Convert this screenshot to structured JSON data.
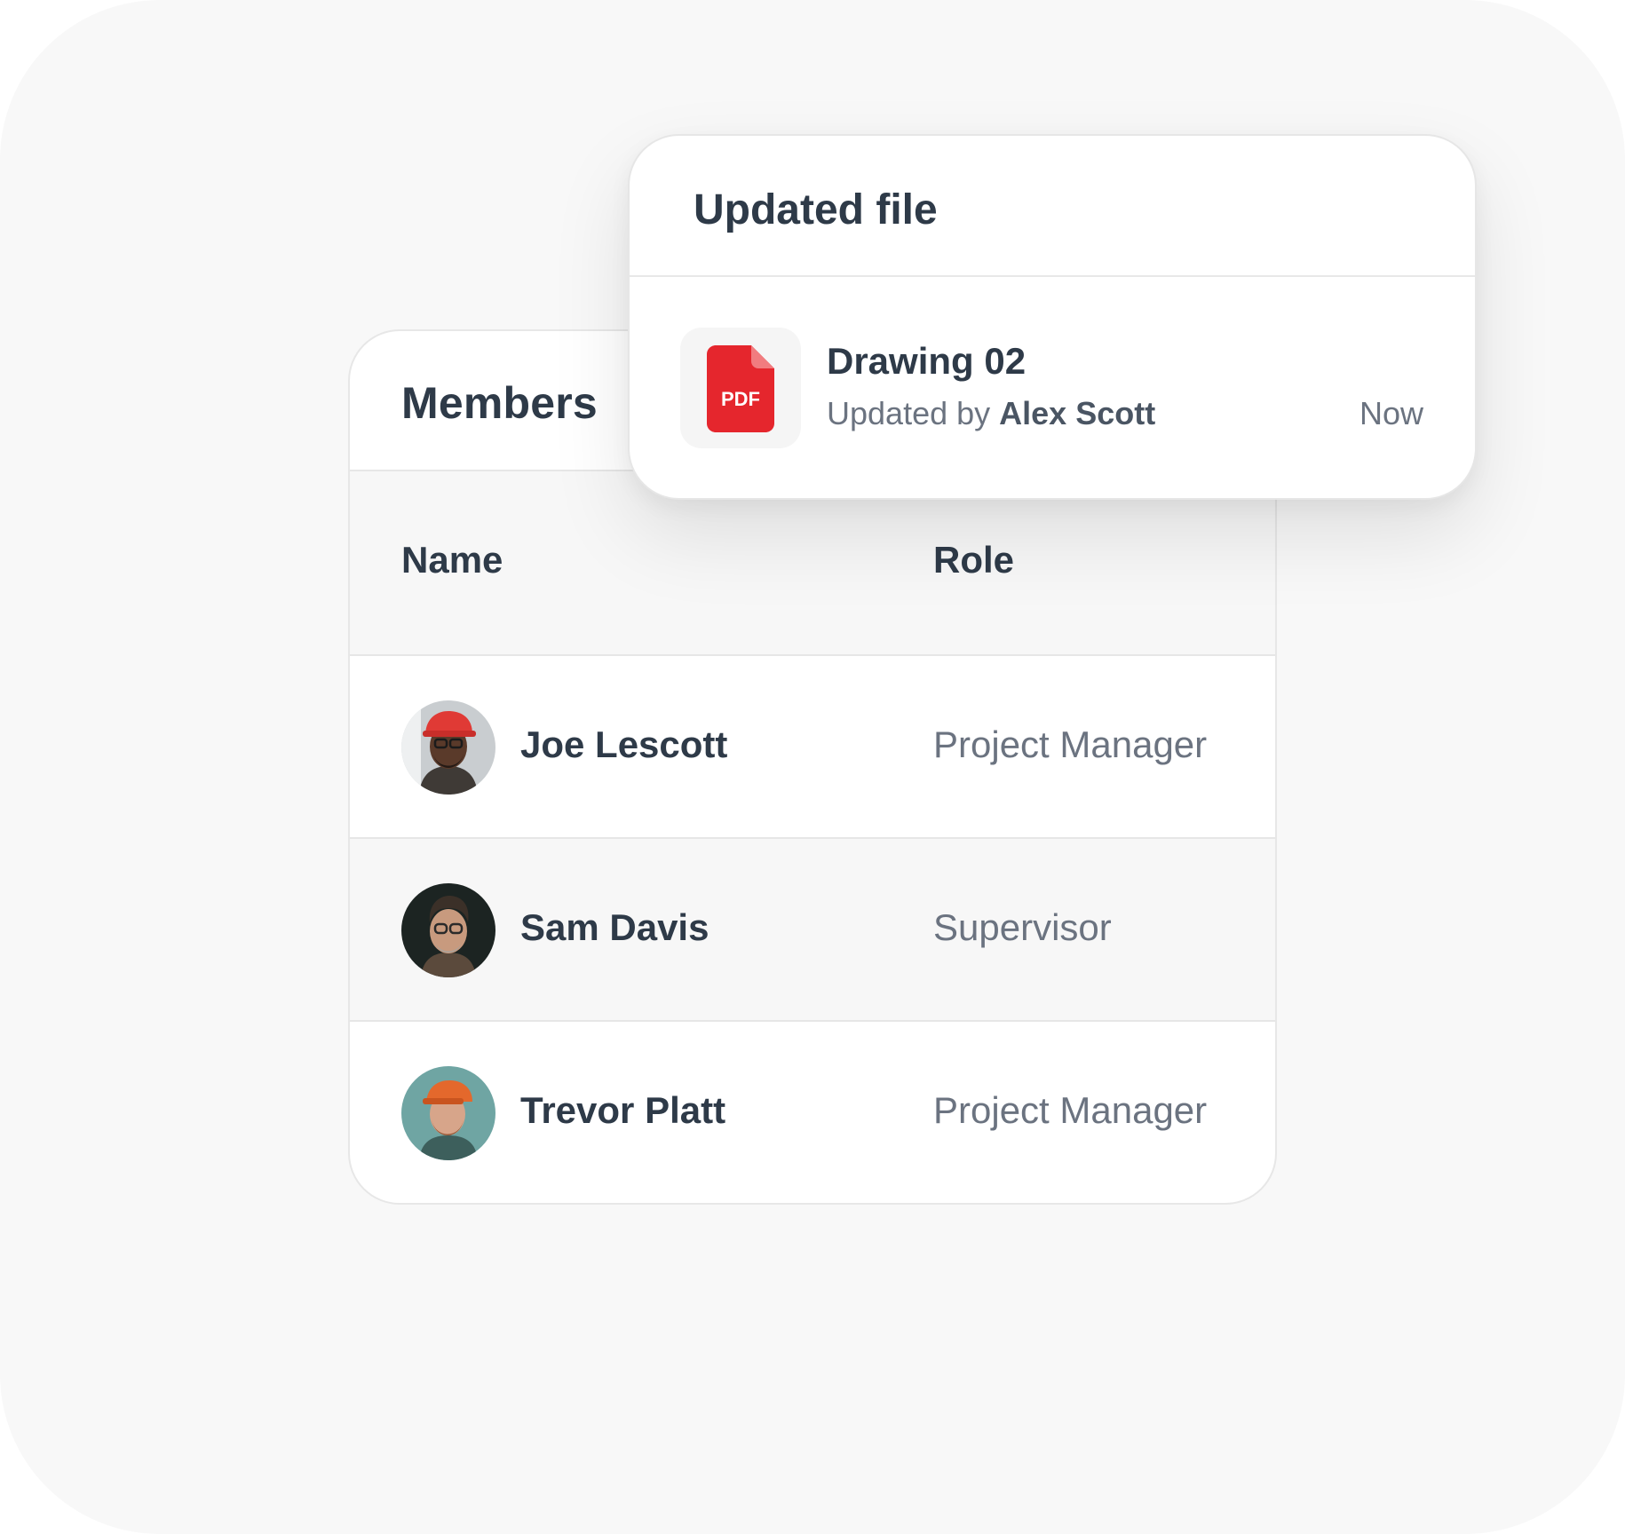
{
  "members": {
    "title": "Members",
    "columns": {
      "name": "Name",
      "role": "Role"
    },
    "rows": [
      {
        "name": "Joe Lescott",
        "role": "Project Manager",
        "avatar": "avatar-red-hardhat"
      },
      {
        "name": "Sam Davis",
        "role": "Supervisor",
        "avatar": "avatar-glasses-man"
      },
      {
        "name": "Trevor Platt",
        "role": "Project Manager",
        "avatar": "avatar-orange-cap"
      }
    ]
  },
  "notification": {
    "title": "Updated file",
    "file": {
      "icon": "pdf-file-icon",
      "icon_label": "PDF",
      "name": "Drawing 02",
      "updated_prefix": "Updated by",
      "updated_by": "Alex Scott",
      "time": "Now"
    }
  },
  "colors": {
    "background": "#f8f8f8",
    "card": "#ffffff",
    "text_primary": "#2e3a48",
    "text_secondary": "#6b7380",
    "pdf_red": "#e5262d"
  }
}
